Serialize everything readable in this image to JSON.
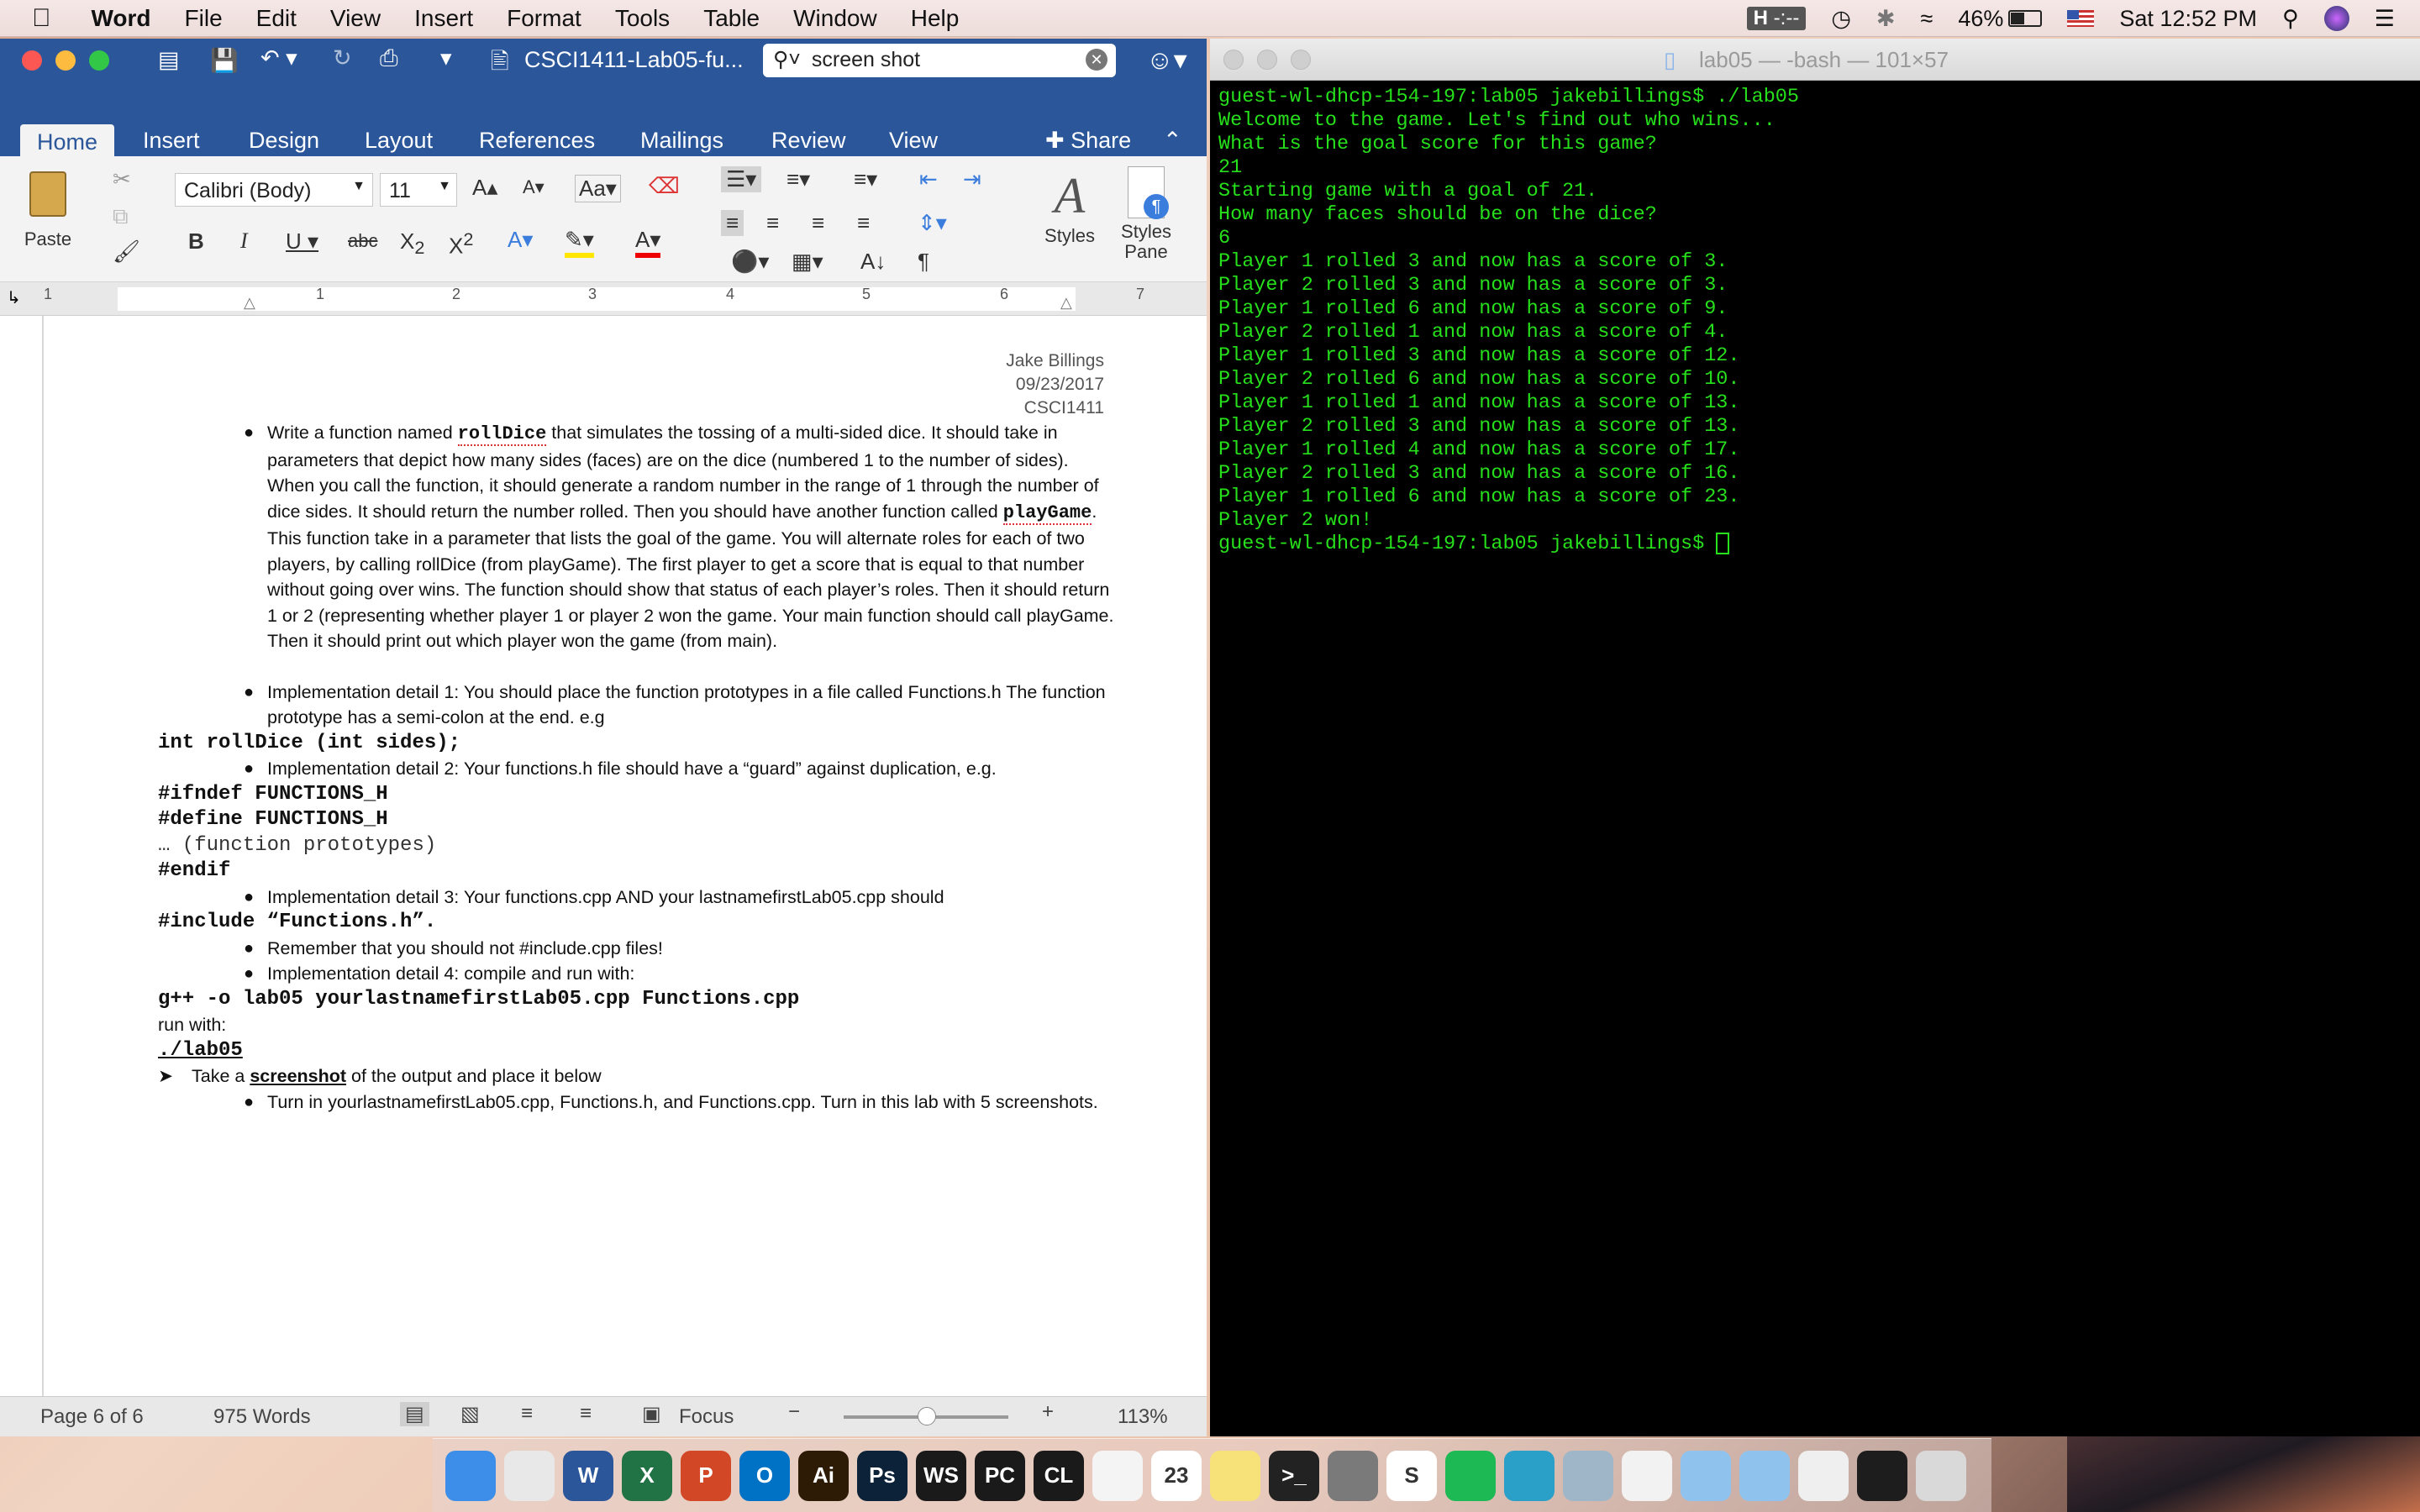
{
  "menubar": {
    "apple": "",
    "app_name": "Word",
    "items": [
      "File",
      "Edit",
      "View",
      "Insert",
      "Format",
      "Tools",
      "Table",
      "Window",
      "Help"
    ],
    "status": {
      "h_badge": "H",
      "h_text": "-:--",
      "battery": "46%",
      "clock": "Sat 12:52 PM"
    }
  },
  "word": {
    "title": "CSCI1411-Lab05-fu...",
    "search_value": "screen shot",
    "tabs": [
      "Home",
      "Insert",
      "Design",
      "Layout",
      "References",
      "Mailings",
      "Review",
      "View"
    ],
    "share_label": "Share",
    "font_name": "Calibri (Body)",
    "font_size": "11",
    "paste_label": "Paste",
    "styles_label": "Styles",
    "styles_pane_label": "Styles Pane",
    "ruler_numbers": [
      "1",
      "1",
      "2",
      "3",
      "4",
      "5",
      "6",
      "7"
    ],
    "doc": {
      "header_name": "Jake Billings",
      "header_date": "09/23/2017",
      "header_course": "CSCI1411",
      "p1_a": "Write a function named ",
      "p1_code1": "rollDice",
      "p1_b": " that simulates the tossing of a multi-sided dice.  It should take in parameters that depict how many sides (faces) are on the dice (numbered 1 to the number of sides).  When you call the function, it should generate a random number in the range of 1 through the number of dice sides.  It should return the number rolled.  Then you should have another function called ",
      "p1_code2": "playGame",
      "p1_c": ".  This function take in a parameter that lists the goal of the game.  You will alternate roles for each of two players, by calling rollDice (from playGame).  The first player to get a score that is equal to that number without going over wins.  The function should show that status of each player’s roles.  Then it should return 1 or 2 (representing whether player 1 or player 2 won the game.  Your main function should call playGame.  Then it should print out which player won the game (from main).",
      "p2": "Implementation detail 1: You should place the function prototypes in a file called Functions.h The function prototype has a semi-colon at the end. e.g",
      "code_proto": "int rollDice (int sides);",
      "p3": "Implementation detail 2: Your functions.h file should have a “guard” against duplication, e.g.",
      "code_ifndef": "#ifndef FUNCTIONS_H",
      "code_define": "#define FUNCTIONS_H",
      "code_proto_comment": "… (function prototypes)",
      "code_endif": "#endif",
      "p4": "Implementation detail 3:  Your functions.cpp AND your lastnamefirstLab05.cpp should",
      "code_include": "#include “Functions.h”.",
      "p5": "Remember that you should not #include.cpp files!",
      "p6": "Implementation detail 4: compile and run with:",
      "code_compile": "g++ -o lab05 yourlastnamefirstLab05.cpp Functions.cpp",
      "run_with": "run with:",
      "code_run": "./lab05",
      "p7_a": "Take a ",
      "p7_b": "screenshot",
      "p7_c": " of the output and place it below",
      "p8": "Turn in yourlastnamefirstLab05.cpp, Functions.h, and Functions.cpp.  Turn in this lab with 5 screenshots."
    },
    "status": {
      "page": "Page 6 of 6",
      "words": "975 Words",
      "focus": "Focus",
      "zoom": "113%"
    }
  },
  "terminal": {
    "title": "lab05 — -bash — 101×57",
    "lines": [
      "guest-wl-dhcp-154-197:lab05 jakebillings$ ./lab05",
      "Welcome to the game. Let's find out who wins...",
      "What is the goal score for this game?",
      "21",
      "Starting game with a goal of 21.",
      "How many faces should be on the dice?",
      "6",
      "Player 1 rolled 3 and now has a score of 3.",
      "Player 2 rolled 3 and now has a score of 3.",
      "Player 1 rolled 6 and now has a score of 9.",
      "Player 2 rolled 1 and now has a score of 4.",
      "Player 1 rolled 3 and now has a score of 12.",
      "Player 2 rolled 6 and now has a score of 10.",
      "Player 1 rolled 1 and now has a score of 13.",
      "Player 2 rolled 3 and now has a score of 13.",
      "Player 1 rolled 4 and now has a score of 17.",
      "Player 2 rolled 3 and now has a score of 16.",
      "Player 1 rolled 6 and now has a score of 23.",
      "Player 2 won!"
    ],
    "prompt": "guest-wl-dhcp-154-197:lab05 jakebillings$ "
  },
  "dock": {
    "apps": [
      {
        "name": "finder-icon",
        "label": "",
        "color": "#3d8ee8"
      },
      {
        "name": "chrome-icon",
        "label": "",
        "color": "#e8e8e8"
      },
      {
        "name": "word-icon",
        "label": "W",
        "color": "#2b579a"
      },
      {
        "name": "excel-icon",
        "label": "X",
        "color": "#217346"
      },
      {
        "name": "powerpoint-icon",
        "label": "P",
        "color": "#d24726"
      },
      {
        "name": "outlook-icon",
        "label": "O",
        "color": "#0072c6"
      },
      {
        "name": "illustrator-icon",
        "label": "Ai",
        "color": "#2d1b05"
      },
      {
        "name": "photoshop-icon",
        "label": "Ps",
        "color": "#0b2238"
      },
      {
        "name": "webstorm-icon",
        "label": "WS",
        "color": "#1a1a1a"
      },
      {
        "name": "pycharm-icon",
        "label": "PC",
        "color": "#1a1a1a"
      },
      {
        "name": "clion-icon",
        "label": "CL",
        "color": "#1a1a1a"
      },
      {
        "name": "reminders-icon",
        "label": "",
        "color": "#f4f4f4"
      },
      {
        "name": "calendar-icon",
        "label": "23",
        "color": "#ffffff"
      },
      {
        "name": "notes-icon",
        "label": "",
        "color": "#f7e27a"
      },
      {
        "name": "terminal-icon",
        "label": ">_",
        "color": "#222222"
      },
      {
        "name": "system-preferences-icon",
        "label": "",
        "color": "#7a7a7a"
      },
      {
        "name": "slack-icon",
        "label": "S",
        "color": "#ffffff"
      },
      {
        "name": "spotify-icon",
        "label": "",
        "color": "#1db954"
      },
      {
        "name": "vpn-icon",
        "label": "",
        "color": "#2aa0c8"
      },
      {
        "name": "preview-icon",
        "label": "",
        "color": "#9fb6c9"
      },
      {
        "name": "document-icon",
        "label": "",
        "color": "#f2f2f2"
      },
      {
        "name": "dropbox-folder-icon",
        "label": "",
        "color": "#8fc3ee"
      },
      {
        "name": "drive-folder-icon",
        "label": "",
        "color": "#8fc3ee"
      },
      {
        "name": "file-icon",
        "label": "",
        "color": "#efefef"
      },
      {
        "name": "terminal-window-icon",
        "label": "",
        "color": "#1d1d1d"
      },
      {
        "name": "trash-icon",
        "label": "",
        "color": "#d9d9d9"
      }
    ]
  },
  "colors": {
    "word_blue": "#2b579a",
    "terminal_green": "#27e01c",
    "terminal_bg": "#000000"
  }
}
